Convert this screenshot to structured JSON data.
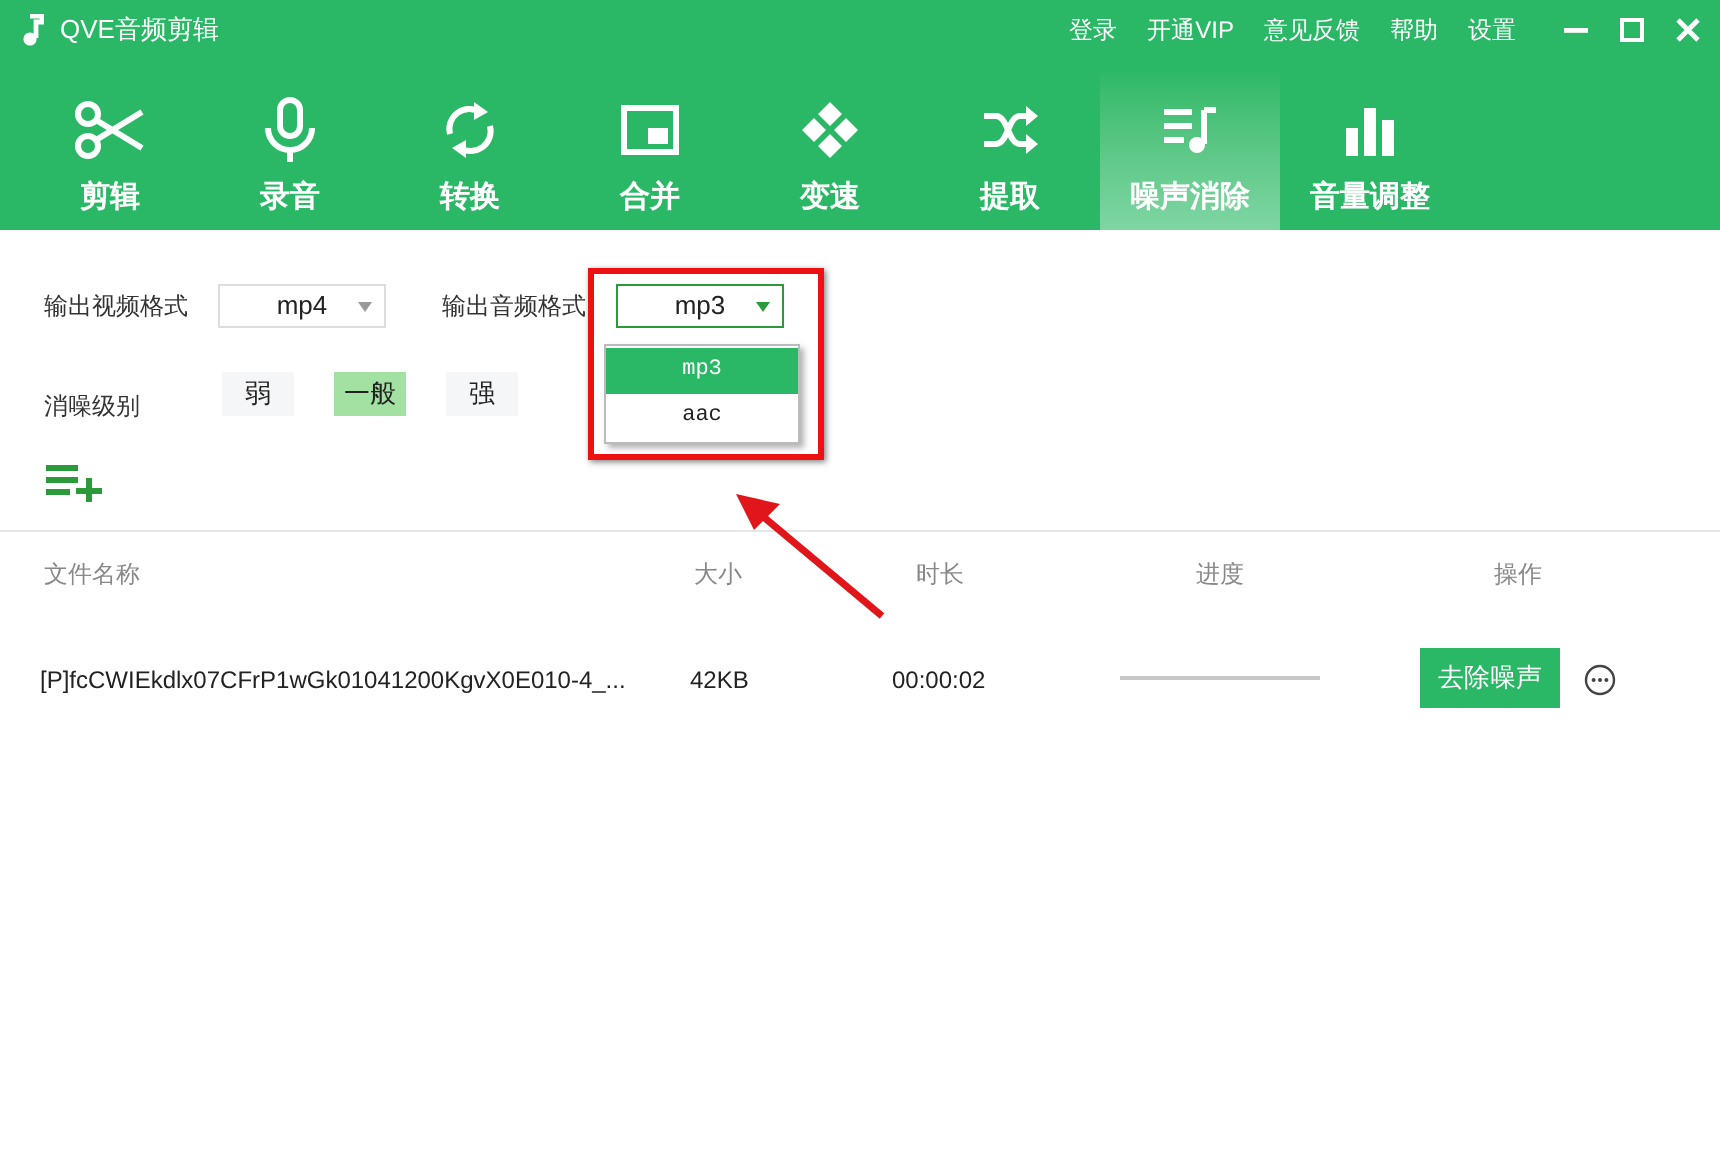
{
  "window": {
    "title": "QVE音频剪辑"
  },
  "top_links": [
    "登录",
    "开通VIP",
    "意见反馈",
    "帮助",
    "设置"
  ],
  "tabs": [
    {
      "label": "剪辑",
      "kind": "scissors",
      "selected": false
    },
    {
      "label": "录音",
      "kind": "mic",
      "selected": false
    },
    {
      "label": "转换",
      "kind": "refresh",
      "selected": false
    },
    {
      "label": "合并",
      "kind": "pip",
      "selected": false
    },
    {
      "label": "变速",
      "kind": "gamepad",
      "selected": false
    },
    {
      "label": "提取",
      "kind": "shuffle",
      "selected": false
    },
    {
      "label": "噪声消除",
      "kind": "notelines",
      "selected": true
    },
    {
      "label": "音量调整",
      "kind": "bars",
      "selected": false
    }
  ],
  "video_format": {
    "label": "输出视频格式",
    "value": "mp4"
  },
  "audio_format": {
    "label": "输出音频格式",
    "value": "mp3",
    "expanded": true,
    "options": [
      {
        "label": "mp3",
        "selected": true
      },
      {
        "label": "aac",
        "selected": false
      }
    ]
  },
  "noise_level": {
    "label": "消噪级别",
    "options": [
      {
        "label": "弱",
        "selected": false
      },
      {
        "label": "一般",
        "selected": true
      },
      {
        "label": "强",
        "selected": false
      }
    ]
  },
  "table": {
    "columns": [
      "文件名称",
      "大小",
      "时长",
      "进度",
      "操作"
    ],
    "rows": [
      {
        "name": "[P]fcCWIEkdlx07CFrP1wGk01041200KgvX0E010-4_...",
        "size": "42KB",
        "duration": "00:00:02",
        "level": 0,
        "action": "去除噪声"
      }
    ]
  }
}
